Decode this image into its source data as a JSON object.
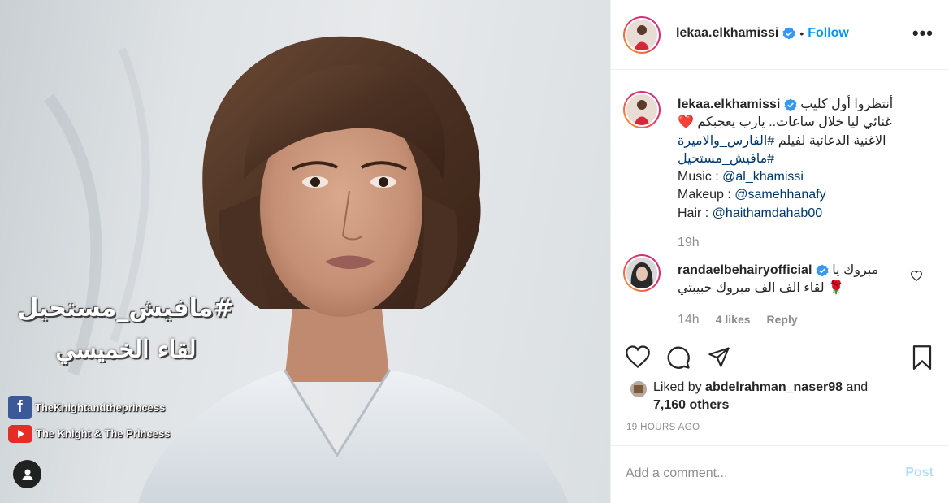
{
  "photo": {
    "overlay_title": "#مافيش_مستحيل",
    "overlay_subtitle": "لقاء الخميسي",
    "facebook_glyph": "f",
    "facebook_page": "TheKnightandtheprincess",
    "youtube_channel": "The Knight & The Princess",
    "user_tag_icon": "person-icon"
  },
  "header": {
    "username": "lekaa.elkhamissi",
    "separator": "•",
    "follow_label": "Follow",
    "more_label": "•••"
  },
  "caption": {
    "username": "lekaa.elkhamissi",
    "line1": "أنتظروا أول كليب",
    "line2": "غنائي ليا خلال ساعات.. يارب يعجبكم ❤️",
    "line3_text": "الاغنية الدعائية لفيلم",
    "line3_hashtag": "#الفارس_والاميرة",
    "line4_hashtag": "#مافيش_مستحيل",
    "music_label": "Music : ",
    "music_handle": "@al_khamissi",
    "makeup_label": "Makeup : ",
    "makeup_handle": "@samehhanafy",
    "hair_label": "Hair : ",
    "hair_handle": "@haithamdahab00",
    "time": "19h"
  },
  "comment": {
    "username": "randaelbehairyofficial",
    "line1": "مبروك يا",
    "line2": "لقاء الف الف مبروك حبيبتي 🌹",
    "time": "14h",
    "likes": "4 likes",
    "reply_label": "Reply"
  },
  "actions": {
    "liked_by_prefix": "Liked by ",
    "liked_by_user": "abdelrahman_naser98",
    "liked_by_suffix": " and",
    "others": "7,160 others",
    "date": "19 HOURS AGO"
  },
  "comment_box": {
    "placeholder": "Add a comment...",
    "post_label": "Post"
  },
  "colors": {
    "accent": "#0095f6",
    "link": "#00376b",
    "muted": "#8e8e8e",
    "heart": "#ed4956"
  }
}
